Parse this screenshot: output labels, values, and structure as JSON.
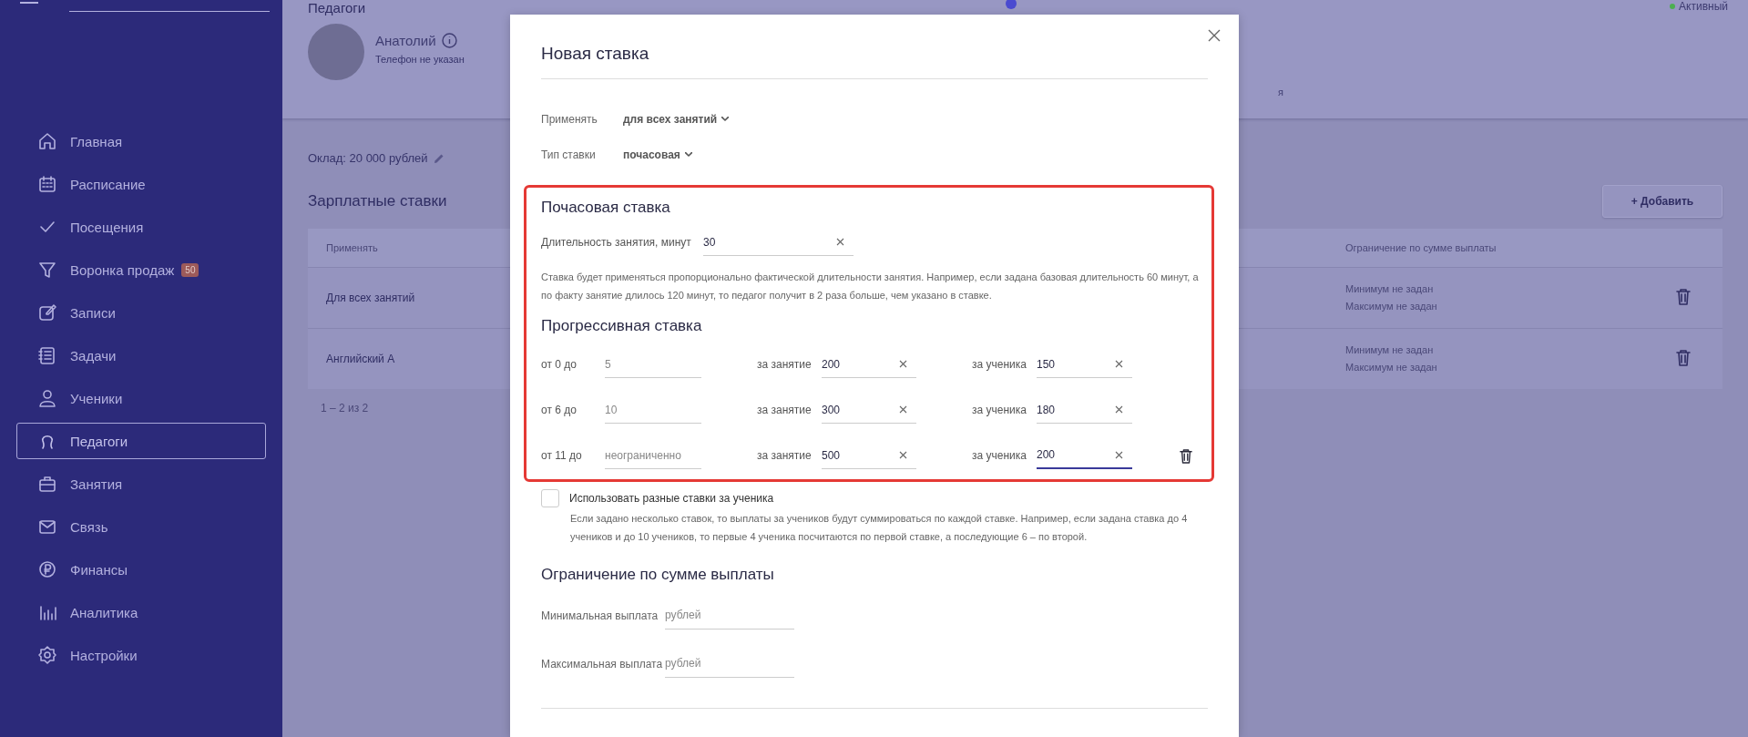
{
  "sidebar": {
    "items": [
      {
        "label": "Главная",
        "selected": false
      },
      {
        "label": "Расписание",
        "selected": false
      },
      {
        "label": "Посещения",
        "selected": false
      },
      {
        "label": "Воронка продаж",
        "selected": false,
        "badge": "50"
      },
      {
        "label": "Записи",
        "selected": false
      },
      {
        "label": "Задачи",
        "selected": false
      },
      {
        "label": "Ученики",
        "selected": false
      },
      {
        "label": "Педагоги",
        "selected": true
      },
      {
        "label": "Занятия",
        "selected": false
      },
      {
        "label": "Связь",
        "selected": false
      },
      {
        "label": "Финансы",
        "selected": false
      },
      {
        "label": "Аналитика",
        "selected": false
      },
      {
        "label": "Настройки",
        "selected": false
      }
    ]
  },
  "header": {
    "page_title": "Педагоги",
    "status": {
      "label": "Активный",
      "color": "#4caf50"
    },
    "teacher": {
      "name": "Анатолий",
      "phone": "Телефон не указан"
    },
    "fragment": "я"
  },
  "salary": {
    "label": "Оклад: 20 000 рублей"
  },
  "rates": {
    "title": "Зарплатные ставки",
    "add_button": "+ Добавить",
    "columns": [
      "Применять",
      "Ограничение по сумме выплаты"
    ],
    "rows": [
      {
        "apply": "Для всех занятий",
        "min": "Минимум не задан",
        "max": "Максимум не задан"
      },
      {
        "apply": "Английский А",
        "min": "Минимум не задан",
        "max": "Максимум не задан"
      }
    ],
    "pagination": "1 – 2 из 2"
  },
  "modal": {
    "title": "Новая ставка",
    "selects": [
      {
        "label": "Применять",
        "value": "для всех занятий"
      },
      {
        "label": "Тип ставки",
        "value": "почасовая"
      }
    ],
    "hourly": {
      "heading": "Почасовая ставка",
      "duration_label": "Длительность занятия, минут",
      "duration": "30",
      "note": "Ставка будет применяться пропорционально фактической длительности занятия. Например, если задана базовая длительность 60 минут, а по факту занятие длилось 120 минут, то педагог получит в 2 раза больше, чем указано в ставке."
    },
    "progressive": {
      "heading": "Прогрессивная ставка",
      "rows": [
        {
          "from_label": "от 0 до",
          "to_placeholder": "5",
          "lesson_label": "за занятие",
          "lesson": "200",
          "student_label": "за ученика",
          "student": "150",
          "focused": false,
          "deletable": false
        },
        {
          "from_label": "от 6 до",
          "to_placeholder": "10",
          "lesson_label": "за занятие",
          "lesson": "300",
          "student_label": "за ученика",
          "student": "180",
          "focused": false,
          "deletable": false
        },
        {
          "from_label": "от 11 до",
          "to_placeholder": "неограниченно",
          "lesson_label": "за занятие",
          "lesson": "500",
          "student_label": "за ученика",
          "student": "200",
          "focused": true,
          "deletable": true
        }
      ]
    },
    "per_student": {
      "label": "Использовать разные ставки за ученика",
      "checked": false,
      "note": "Если задано несколько ставок, то выплаты за учеников будут суммироваться по каждой ставке. Например, если задана ставка до 4 учеников и до 10 учеников, то первые 4 ученика посчитаются по первой ставке, а последующие 6 – по второй."
    },
    "limit": {
      "heading": "Ограничение по сумме выплаты",
      "fields": [
        {
          "label": "Минимальная выплата",
          "placeholder": "рублей"
        },
        {
          "label": "Максимальная выплата",
          "placeholder": "рублей"
        }
      ]
    }
  }
}
